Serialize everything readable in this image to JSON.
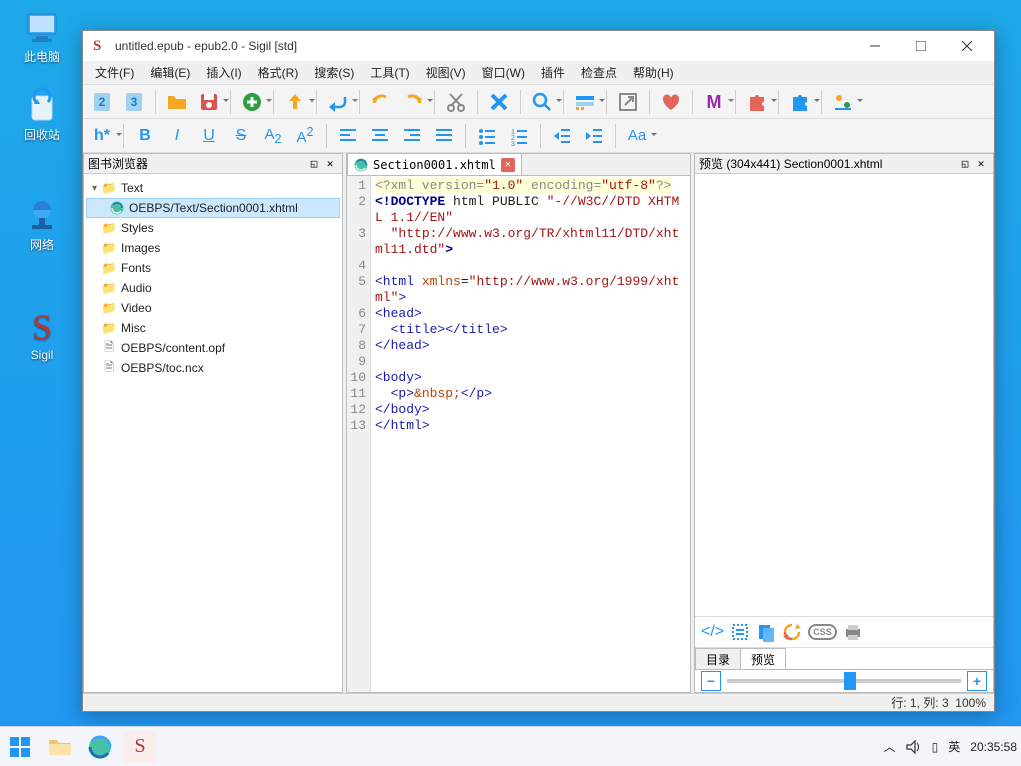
{
  "desktop": {
    "this_pc": "此电脑",
    "recycle": "回收站",
    "network": "网络",
    "sigil": "Sigil"
  },
  "window": {
    "title": "untitled.epub - epub2.0 - Sigil [std]"
  },
  "menu": {
    "file": "文件(F)",
    "edit": "编辑(E)",
    "insert": "插入(I)",
    "format": "格式(R)",
    "search": "搜索(S)",
    "tools": "工具(T)",
    "view": "视图(V)",
    "window": "窗口(W)",
    "plugins": "插件",
    "checkpoint": "检查点",
    "help": "帮助(H)"
  },
  "panels": {
    "book_browser": "图书浏览器",
    "preview_title": "预览 (304x441) Section0001.xhtml",
    "tab_toc": "目录",
    "tab_preview": "预览"
  },
  "tree": {
    "text": "Text",
    "section_file": "OEBPS/Text/Section0001.xhtml",
    "styles": "Styles",
    "images": "Images",
    "fonts": "Fonts",
    "audio": "Audio",
    "video": "Video",
    "misc": "Misc",
    "opf": "OEBPS/content.opf",
    "ncx": "OEBPS/toc.ncx"
  },
  "editor": {
    "tab": "Section0001.xhtml",
    "lines": [
      "1",
      "2",
      "3",
      "4",
      "5",
      "6",
      "7",
      "8",
      "9",
      "10",
      "11",
      "12",
      "13"
    ],
    "code": {
      "l1": "<?xml version=\"1.0\" encoding=\"utf-8\"?>",
      "l2": "<!DOCTYPE html PUBLIC \"-//W3C//DTD XHTML 1.1//EN\"",
      "l3": "  \"http://www.w3.org/TR/xhtml11/DTD/xhtml11.dtd\">",
      "l4": "",
      "l5": "<html xmlns=\"http://www.w3.org/1999/xhtml\">",
      "l6": "<head>",
      "l7": "  <title></title>",
      "l8": "</head>",
      "l9": "",
      "l10": "<body>",
      "l11": "  <p>&nbsp;</p>",
      "l12": "</body>",
      "l13": "</html>"
    }
  },
  "status": {
    "position": "行: 1, 列: 3",
    "zoom": "100%"
  },
  "taskbar": {
    "ime1": "▯",
    "ime2": "英",
    "time": "20:35:58"
  }
}
